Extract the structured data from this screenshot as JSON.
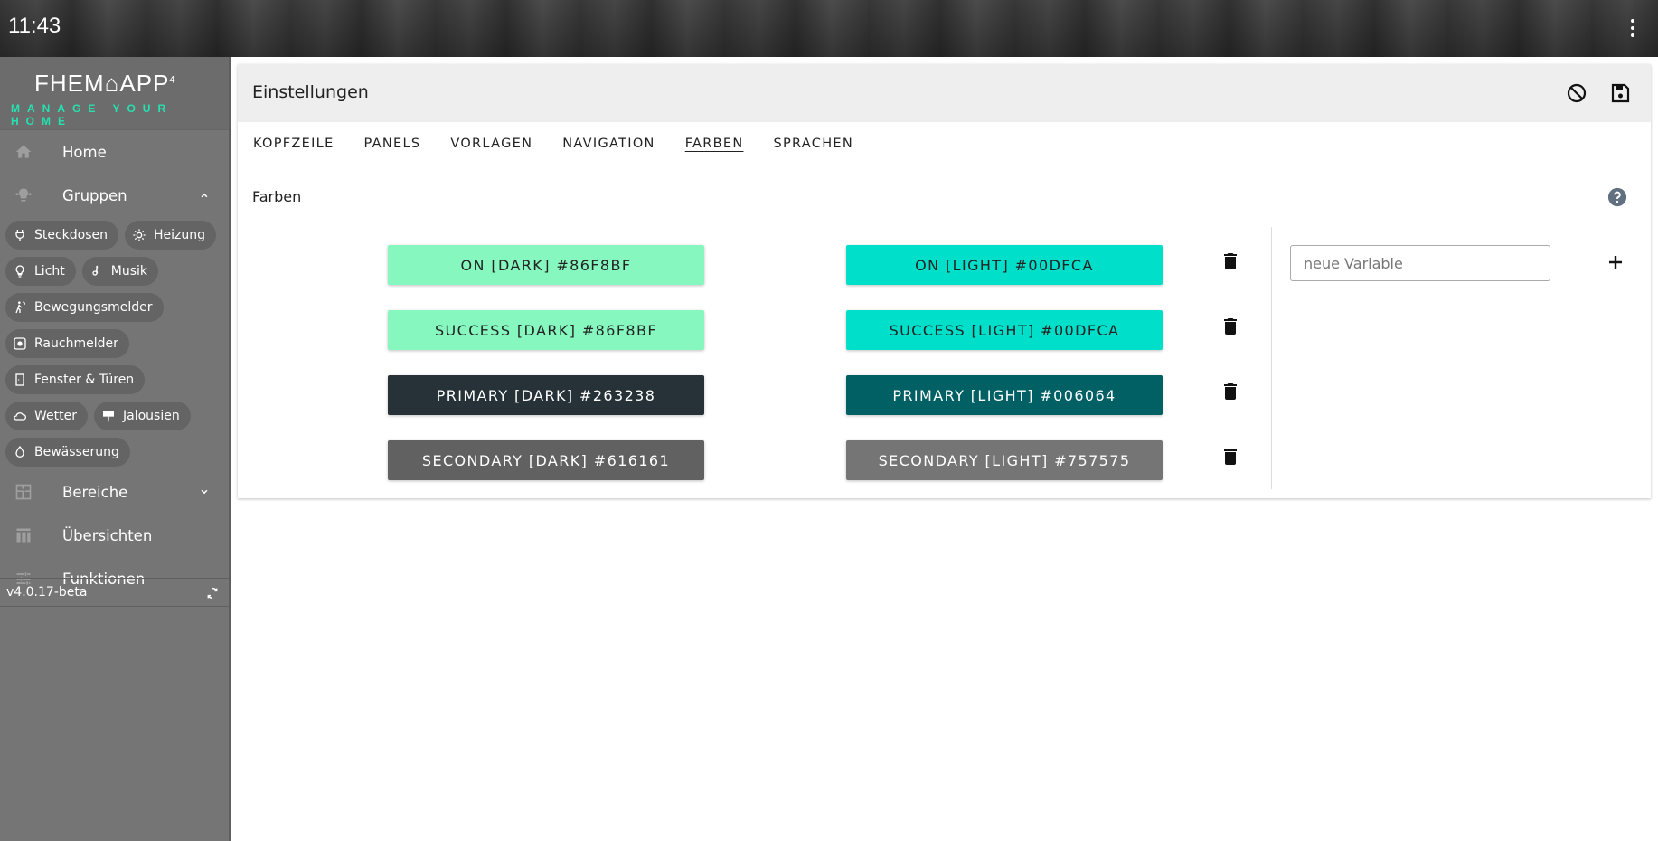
{
  "topbar": {
    "time": "11:43"
  },
  "sidebar": {
    "logo_title": "FHEM",
    "logo_title_2": "APP",
    "logo_version_mark": "4",
    "logo_subtitle": "MANAGE YOUR HOME",
    "home": "Home",
    "groups": "Gruppen",
    "group_chips": [
      {
        "label": "Steckdosen",
        "icon": "plug-icon"
      },
      {
        "label": "Heizung",
        "icon": "heater-icon"
      },
      {
        "label": "Licht",
        "icon": "bulb-icon"
      },
      {
        "label": "Musik",
        "icon": "music-icon"
      },
      {
        "label": "Bewegungsmelder",
        "icon": "motion-icon"
      },
      {
        "label": "Rauchmelder",
        "icon": "smoke-detector-icon"
      },
      {
        "label": "Fenster & Türen",
        "icon": "door-icon"
      },
      {
        "label": "Wetter",
        "icon": "weather-icon"
      },
      {
        "label": "Jalousien",
        "icon": "blinds-icon"
      },
      {
        "label": "Bewässerung",
        "icon": "water-drop-icon"
      }
    ],
    "areas": "Bereiche",
    "overviews": "Übersichten",
    "functions": "Funktionen",
    "version": "v4.0.17-beta"
  },
  "panel": {
    "title": "Einstellungen",
    "tabs": [
      "KOPFZEILE",
      "PANELS",
      "VORLAGEN",
      "NAVIGATION",
      "FARBEN",
      "SPRACHEN"
    ],
    "active_tab": "FARBEN",
    "section_title": "Farben",
    "colors": [
      {
        "dark_label": "ON [DARK] #86F8BF",
        "dark_color": "#86F8BF",
        "dark_text": "#222222",
        "light_label": "ON [LIGHT] #00DFCA",
        "light_color": "#00DFCA",
        "light_text": "#222222"
      },
      {
        "dark_label": "SUCCESS [DARK] #86F8BF",
        "dark_color": "#86F8BF",
        "dark_text": "#222222",
        "light_label": "SUCCESS [LIGHT] #00DFCA",
        "light_color": "#00DFCA",
        "light_text": "#222222"
      },
      {
        "dark_label": "PRIMARY [DARK] #263238",
        "dark_color": "#263238",
        "dark_text": "#ffffff",
        "light_label": "PRIMARY [LIGHT] #006064",
        "light_color": "#006064",
        "light_text": "#ffffff"
      },
      {
        "dark_label": "SECONDARY [DARK] #616161",
        "dark_color": "#616161",
        "dark_text": "#ffffff",
        "light_label": "SECONDARY [LIGHT] #757575",
        "light_color": "#757575",
        "light_text": "#ffffff"
      }
    ],
    "new_variable_placeholder": "neue Variable"
  }
}
